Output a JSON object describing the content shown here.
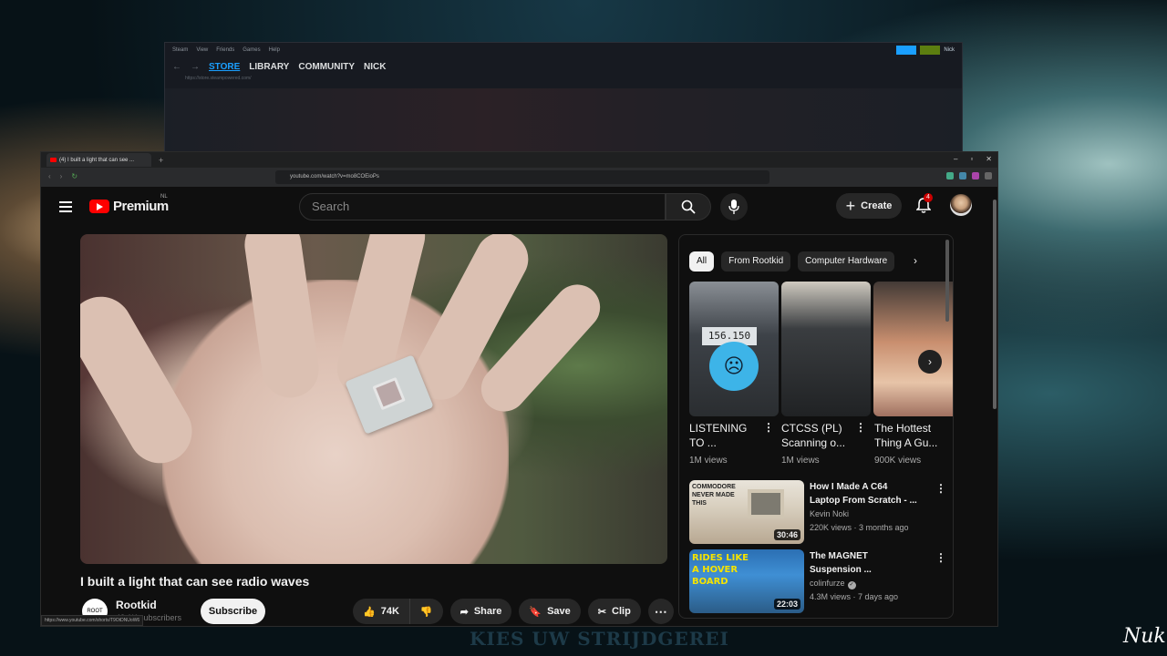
{
  "desktop": {
    "bottom_text": "KIES UW STRIJDGEREI",
    "corner_logo": "Nuk"
  },
  "steam": {
    "menu": [
      "Steam",
      "View",
      "Friends",
      "Games",
      "Help"
    ],
    "nav": [
      "STORE",
      "LIBRARY",
      "COMMUNITY",
      "NICK"
    ],
    "url": "https://store.steampowered.com/",
    "user": "Nick"
  },
  "browser": {
    "tab_title": "(4) I built a light that can see ...",
    "url": "youtube.com/watch?v=mo8COEioPs"
  },
  "youtube": {
    "logo_text": "Premium",
    "logo_region": "NL",
    "search_placeholder": "Search",
    "create_label": "Create",
    "notification_count": "4",
    "video": {
      "title": "I built a light that can see radio waves",
      "channel": "Rootkid",
      "channel_avatar_text": "ROOT",
      "subscribers": "43.1K subscribers",
      "subscribe_label": "Subscribe",
      "likes": "74K",
      "share_label": "Share",
      "save_label": "Save",
      "clip_label": "Clip"
    },
    "status_url": "https://www.youtube.com/shorts/T9OtDNUoW6",
    "filters": [
      "All",
      "From Rootkid",
      "Computer Hardware"
    ],
    "shorts": [
      {
        "title": "LISTENING TO ...",
        "views": "1M views",
        "screen": "156.150"
      },
      {
        "title": "CTCSS (PL) Scanning o...",
        "views": "1M views"
      },
      {
        "title": "The Hottest Thing A Gu...",
        "views": "900K views"
      }
    ],
    "recommendations": [
      {
        "title": "How I Made A C64 Laptop From Scratch - ...",
        "channel": "Kevin Noki",
        "meta": "220K views · 3 months ago",
        "duration": "30:46",
        "thumb_text": "COMMODORE NEVER MADE THIS"
      },
      {
        "title": "The MAGNET Suspension ...",
        "channel": "colinfurze",
        "meta": "4.3M views · 7 days ago",
        "duration": "22:03",
        "thumb_text": "RIDES LIKE A HOVER BOARD"
      }
    ]
  }
}
